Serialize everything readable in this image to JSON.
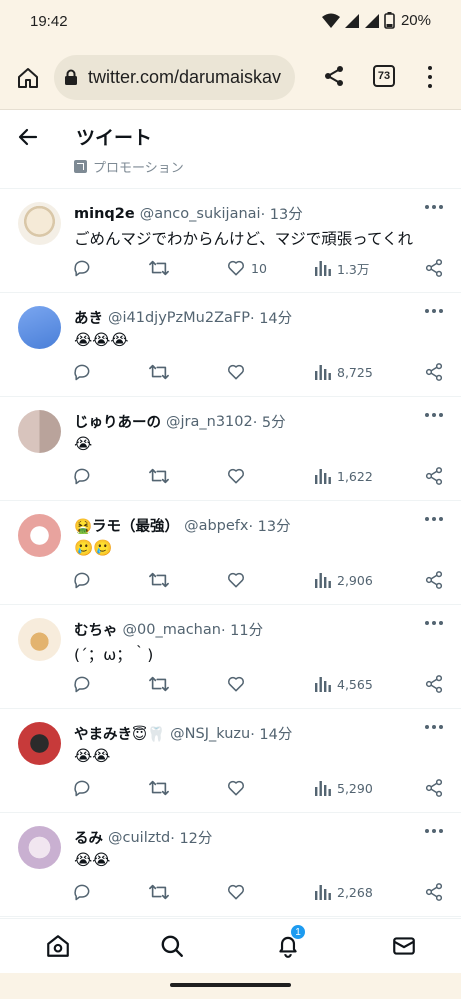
{
  "status_bar": {
    "time": "19:42",
    "battery_pct": "20%"
  },
  "browser": {
    "url": "twitter.com/darumaiskav",
    "tab_count": "73"
  },
  "header": {
    "title": "ツイート",
    "promotion_label": "プロモーション"
  },
  "tweets": [
    {
      "name": "minq2e",
      "handle": "@anco_sukijanai",
      "time": " · 13分",
      "body": "ごめんマジでわからんけど、マジで頑張ってくれ",
      "likes": "10",
      "views": "1.3万"
    },
    {
      "name": "あき",
      "handle": "@i41djyPzMu2ZaFP",
      "time": " · 14分",
      "body": "😭😭😭",
      "likes": "",
      "views": "8,725"
    },
    {
      "name": "じゅりあーの",
      "handle": "@jra_n3102",
      "time": " · 5分",
      "body": "😭",
      "likes": "",
      "views": "1,622"
    },
    {
      "name": "🤮ラモ（最強）",
      "handle": "@abpefx",
      "time": " · 13分",
      "body": "🥲🥲",
      "likes": "",
      "views": "2,906"
    },
    {
      "name": "むちゃ",
      "handle": "@00_machan",
      "time": " · 11分",
      "body": "(´；ω；｀)",
      "likes": "",
      "views": "4,565"
    },
    {
      "name": "やまみき😇🦷",
      "handle": "@NSJ_kuzu",
      "time": " · 14分",
      "body": "😭😭",
      "likes": "",
      "views": "5,290"
    },
    {
      "name": "るみ",
      "handle": "@cuilztd",
      "time": " · 12分",
      "body": "😭😭",
      "likes": "",
      "views": "2,268"
    }
  ],
  "bottom_nav": {
    "notification_badge": "1",
    "items": [
      "home-icon",
      "search-icon",
      "bell-icon",
      "mail-icon"
    ]
  },
  "colors": {
    "accent": "#1d9bf0",
    "text_secondary": "#536471",
    "chrome_bg": "#faf3e6"
  }
}
